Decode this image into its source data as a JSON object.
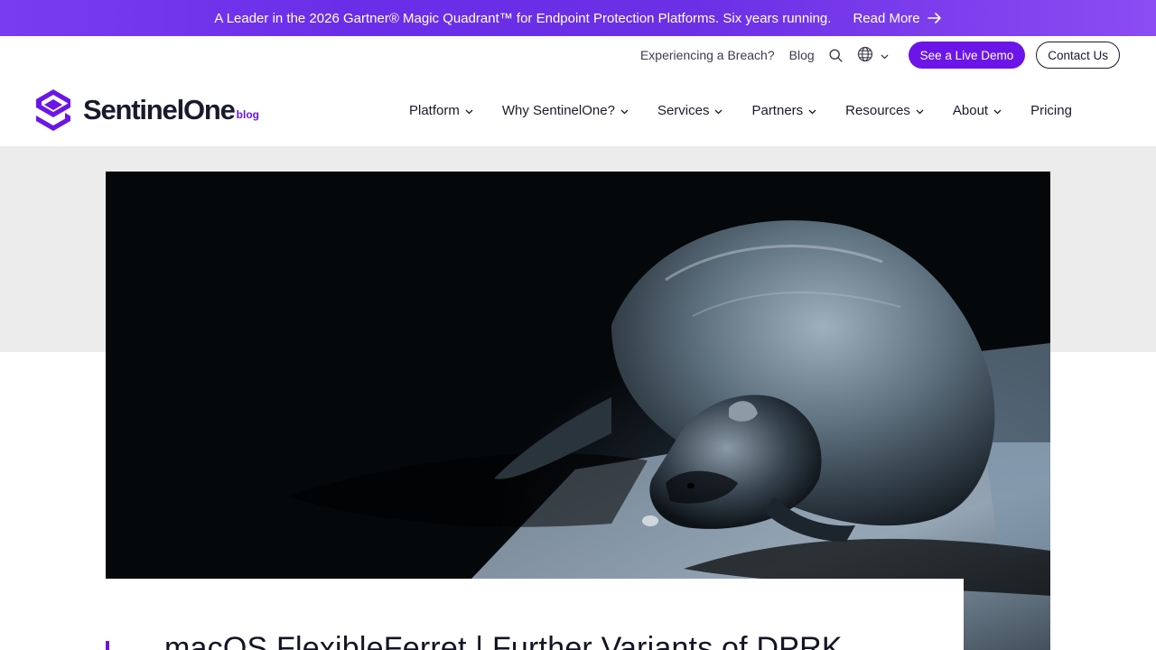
{
  "banner": {
    "text": "A Leader in the 2026 Gartner® Magic Quadrant™ for Endpoint Protection Platforms. Six years running.",
    "link_label": "Read More",
    "link_icon": "arrow-right-icon"
  },
  "utility_nav": {
    "breach_link": "Experiencing a Breach?",
    "blog_link": "Blog",
    "search_icon": "search-icon",
    "language_icon": "globe-icon",
    "demo_button": "See a Live Demo",
    "contact_button": "Contact Us"
  },
  "header": {
    "logo_text": "SentinelOne",
    "logo_suffix": "blog",
    "menu": [
      {
        "label": "Platform",
        "has_dropdown": true
      },
      {
        "label": "Why SentinelOne?",
        "has_dropdown": true
      },
      {
        "label": "Services",
        "has_dropdown": true
      },
      {
        "label": "Partners",
        "has_dropdown": true
      },
      {
        "label": "Resources",
        "has_dropdown": true
      },
      {
        "label": "About",
        "has_dropdown": true
      },
      {
        "label": "Pricing",
        "has_dropdown": false
      }
    ]
  },
  "article": {
    "title": "macOS FlexibleFerret | Further Variants of DPRK"
  },
  "colors": {
    "accent": "#6b15e8",
    "banner_gradient_start": "#7a3cf0",
    "text_dark": "#1a1a2e",
    "band_gray": "#ececec"
  }
}
